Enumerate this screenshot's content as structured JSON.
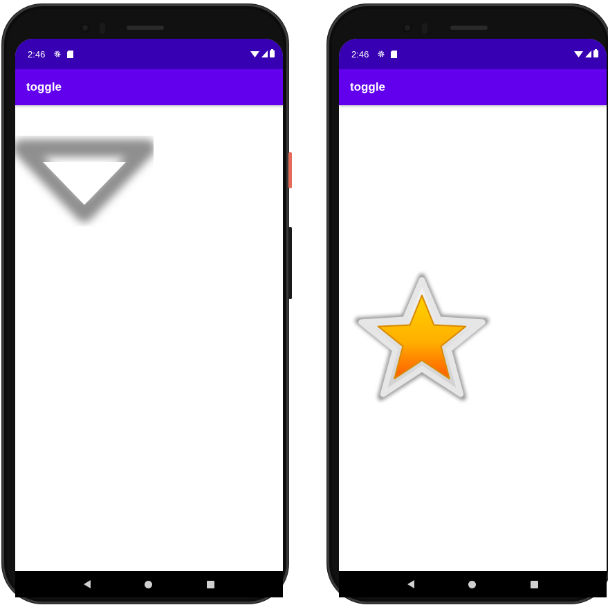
{
  "phones": [
    {
      "status": {
        "time": "2:46"
      },
      "app_title": "toggle",
      "toggle_state": "off",
      "toggle_icon": "arrow-down-icon"
    },
    {
      "status": {
        "time": "2:46"
      },
      "app_title": "toggle",
      "toggle_state": "on",
      "toggle_icon": "star-icon"
    }
  ],
  "colors": {
    "status_bar": "#3700b3",
    "app_bar": "#6200ee",
    "star_fill_top": "#ffcc00",
    "star_fill_bottom": "#ff6a00"
  }
}
